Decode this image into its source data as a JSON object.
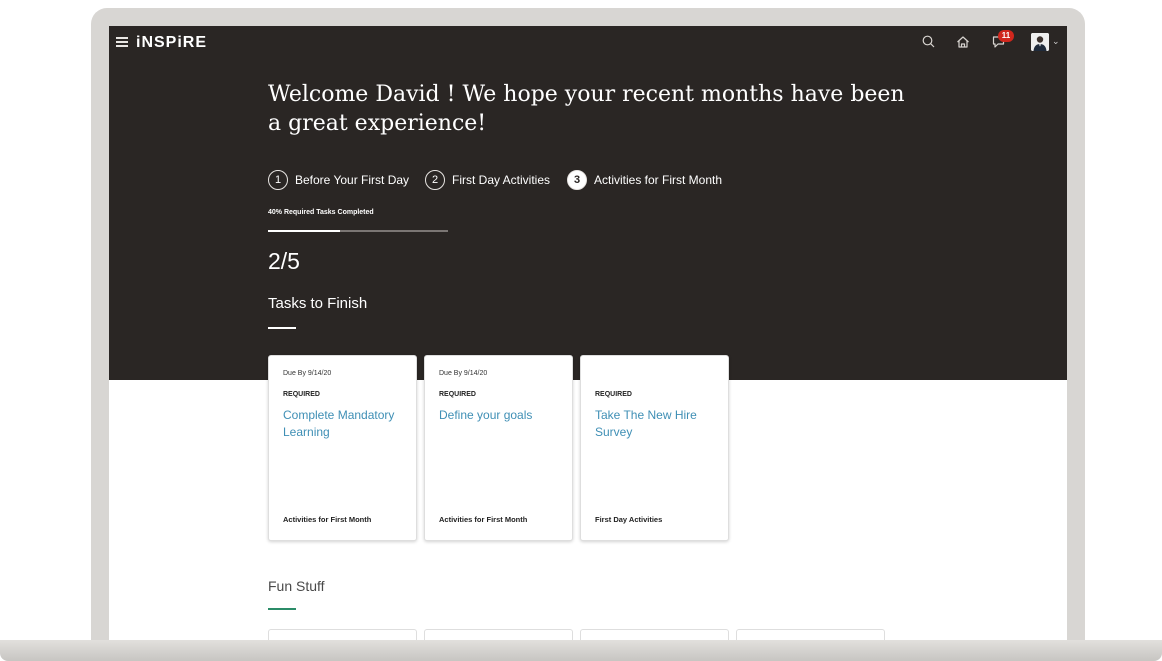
{
  "app": {
    "brand": "iNSPiRE"
  },
  "header": {
    "notification_count": "11"
  },
  "welcome": {
    "message": "Welcome David ! We hope your recent months have been a great experience!"
  },
  "steps": [
    {
      "number": "1",
      "label": "Before Your First Day",
      "active": false
    },
    {
      "number": "2",
      "label": "First Day Activities",
      "active": false
    },
    {
      "number": "3",
      "label": "Activities for First Month",
      "active": true
    }
  ],
  "progress": {
    "label": "40% Required Tasks Completed",
    "percent": 40,
    "count": "2/5"
  },
  "tasks": {
    "heading": "Tasks to Finish",
    "cards": [
      {
        "due": "Due By 9/14/20",
        "status": "REQUIRED",
        "title": "Complete Mandatory Learning",
        "phase": "Activities for First Month"
      },
      {
        "due": "Due By 9/14/20",
        "status": "REQUIRED",
        "title": "Define your goals",
        "phase": "Activities for First Month"
      },
      {
        "due": "",
        "status": "REQUIRED",
        "title": "Take The New Hire Survey",
        "phase": "First Day Activities"
      }
    ]
  },
  "fun": {
    "heading": "Fun Stuff"
  },
  "colors": {
    "hero_bg": "#2a2624",
    "link": "#3f8fb5",
    "accent_green": "#2b8c68",
    "badge_red": "#d0271d"
  },
  "icons": [
    "menu-icon",
    "search-icon",
    "home-icon",
    "chat-icon",
    "avatar"
  ]
}
